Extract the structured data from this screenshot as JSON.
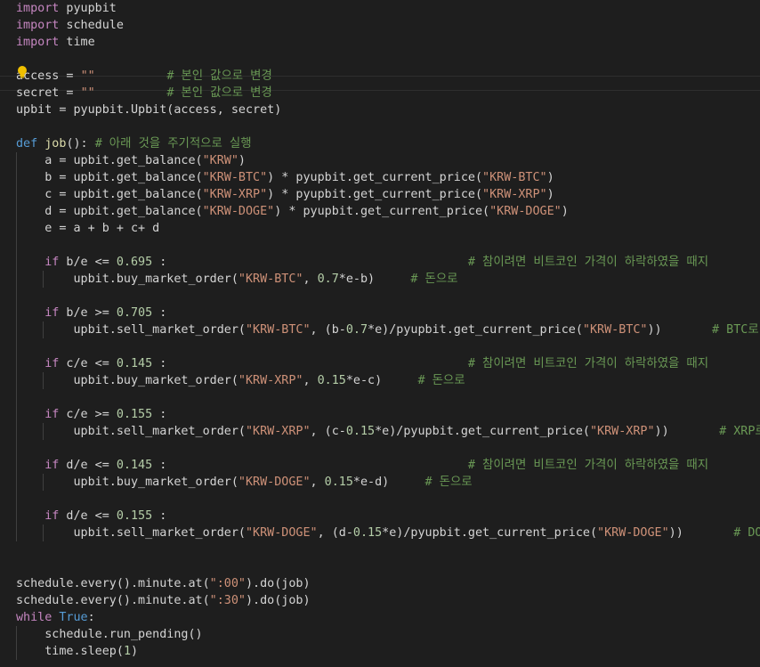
{
  "editor": {
    "lines": [
      [
        [
          "kw2",
          "import"
        ],
        [
          "tr",
          " pyupbit"
        ]
      ],
      [
        [
          "kw2",
          "import"
        ],
        [
          "tr",
          " schedule"
        ]
      ],
      [
        [
          "kw2",
          "import"
        ],
        [
          "tr",
          " time"
        ]
      ],
      [],
      [
        [
          "tr",
          "access = "
        ],
        [
          "str",
          "\"\""
        ],
        [
          "tr",
          "          "
        ],
        [
          "cm",
          "# 본인 값으로 변경"
        ]
      ],
      [
        [
          "tr",
          "secret = "
        ],
        [
          "str",
          "\"\""
        ],
        [
          "tr",
          "          "
        ],
        [
          "cm",
          "# 본인 값으로 변경"
        ]
      ],
      [
        [
          "tr",
          "upbit = pyupbit.Upbit(access, secret)"
        ]
      ],
      [],
      [
        [
          "kw",
          "def"
        ],
        [
          "tr",
          " "
        ],
        [
          "fn",
          "job"
        ],
        [
          "tr",
          "(): "
        ],
        [
          "cm",
          "# 아래 것을 주기적으로 실행"
        ]
      ],
      [
        [
          "tr",
          "    a = upbit.get_balance("
        ],
        [
          "str",
          "\"KRW\""
        ],
        [
          "tr",
          ")"
        ]
      ],
      [
        [
          "tr",
          "    b = upbit.get_balance("
        ],
        [
          "str",
          "\"KRW-BTC\""
        ],
        [
          "tr",
          ") * pyupbit.get_current_price("
        ],
        [
          "str",
          "\"KRW-BTC\""
        ],
        [
          "tr",
          ")"
        ]
      ],
      [
        [
          "tr",
          "    c = upbit.get_balance("
        ],
        [
          "str",
          "\"KRW-XRP\""
        ],
        [
          "tr",
          ") * pyupbit.get_current_price("
        ],
        [
          "str",
          "\"KRW-XRP\""
        ],
        [
          "tr",
          ")"
        ]
      ],
      [
        [
          "tr",
          "    d = upbit.get_balance("
        ],
        [
          "str",
          "\"KRW-DOGE\""
        ],
        [
          "tr",
          ") * pyupbit.get_current_price("
        ],
        [
          "str",
          "\"KRW-DOGE\""
        ],
        [
          "tr",
          ")"
        ]
      ],
      [
        [
          "tr",
          "    e = a + b + c+ d"
        ]
      ],
      [],
      [
        [
          "tr",
          "    "
        ],
        [
          "kw2",
          "if"
        ],
        [
          "tr",
          " b/e <= "
        ],
        [
          "num",
          "0.695"
        ],
        [
          "tr",
          " :                                          "
        ],
        [
          "cm",
          "# 참이려면 비트코인 가격이 하락하였을 때지"
        ]
      ],
      [
        [
          "tr",
          "        upbit.buy_market_order("
        ],
        [
          "str",
          "\"KRW-BTC\""
        ],
        [
          "tr",
          ", "
        ],
        [
          "num",
          "0.7"
        ],
        [
          "tr",
          "*e-b)     "
        ],
        [
          "cm",
          "# 돈으로"
        ]
      ],
      [],
      [
        [
          "tr",
          "    "
        ],
        [
          "kw2",
          "if"
        ],
        [
          "tr",
          " b/e >= "
        ],
        [
          "num",
          "0.705"
        ],
        [
          "tr",
          " :"
        ]
      ],
      [
        [
          "tr",
          "        upbit.sell_market_order("
        ],
        [
          "str",
          "\"KRW-BTC\""
        ],
        [
          "tr",
          ", (b-"
        ],
        [
          "num",
          "0.7"
        ],
        [
          "tr",
          "*e)/pyupbit.get_current_price("
        ],
        [
          "str",
          "\"KRW-BTC\""
        ],
        [
          "tr",
          "))       "
        ],
        [
          "cm",
          "# BTC로"
        ]
      ],
      [],
      [
        [
          "tr",
          "    "
        ],
        [
          "kw2",
          "if"
        ],
        [
          "tr",
          " c/e <= "
        ],
        [
          "num",
          "0.145"
        ],
        [
          "tr",
          " :                                          "
        ],
        [
          "cm",
          "# 참이려면 비트코인 가격이 하락하였을 때지"
        ]
      ],
      [
        [
          "tr",
          "        upbit.buy_market_order("
        ],
        [
          "str",
          "\"KRW-XRP\""
        ],
        [
          "tr",
          ", "
        ],
        [
          "num",
          "0.15"
        ],
        [
          "tr",
          "*e-c)     "
        ],
        [
          "cm",
          "# 돈으로"
        ]
      ],
      [],
      [
        [
          "tr",
          "    "
        ],
        [
          "kw2",
          "if"
        ],
        [
          "tr",
          " c/e >= "
        ],
        [
          "num",
          "0.155"
        ],
        [
          "tr",
          " :"
        ]
      ],
      [
        [
          "tr",
          "        upbit.sell_market_order("
        ],
        [
          "str",
          "\"KRW-XRP\""
        ],
        [
          "tr",
          ", (c-"
        ],
        [
          "num",
          "0.15"
        ],
        [
          "tr",
          "*e)/pyupbit.get_current_price("
        ],
        [
          "str",
          "\"KRW-XRP\""
        ],
        [
          "tr",
          "))       "
        ],
        [
          "cm",
          "# XRP로"
        ]
      ],
      [],
      [
        [
          "tr",
          "    "
        ],
        [
          "kw2",
          "if"
        ],
        [
          "tr",
          " d/e <= "
        ],
        [
          "num",
          "0.145"
        ],
        [
          "tr",
          " :                                          "
        ],
        [
          "cm",
          "# 참이려면 비트코인 가격이 하락하였을 때지"
        ]
      ],
      [
        [
          "tr",
          "        upbit.buy_market_order("
        ],
        [
          "str",
          "\"KRW-DOGE\""
        ],
        [
          "tr",
          ", "
        ],
        [
          "num",
          "0.15"
        ],
        [
          "tr",
          "*e-d)     "
        ],
        [
          "cm",
          "# 돈으로"
        ]
      ],
      [],
      [
        [
          "tr",
          "    "
        ],
        [
          "kw2",
          "if"
        ],
        [
          "tr",
          " d/e <= "
        ],
        [
          "num",
          "0.155"
        ],
        [
          "tr",
          " :"
        ]
      ],
      [
        [
          "tr",
          "        upbit.sell_market_order("
        ],
        [
          "str",
          "\"KRW-DOGE\""
        ],
        [
          "tr",
          ", (d-"
        ],
        [
          "num",
          "0.15"
        ],
        [
          "tr",
          "*e)/pyupbit.get_current_price("
        ],
        [
          "str",
          "\"KRW-DOGE\""
        ],
        [
          "tr",
          "))       "
        ],
        [
          "cm",
          "# DOGE로"
        ]
      ],
      [],
      [],
      [
        [
          "tr",
          "schedule.every().minute.at("
        ],
        [
          "str",
          "\":00\""
        ],
        [
          "tr",
          ").do(job)"
        ]
      ],
      [
        [
          "tr",
          "schedule.every().minute.at("
        ],
        [
          "str",
          "\":30\""
        ],
        [
          "tr",
          ").do(job)"
        ]
      ],
      [
        [
          "kw2",
          "while"
        ],
        [
          "tr",
          " "
        ],
        [
          "kw",
          "True"
        ],
        [
          "tr",
          ":"
        ]
      ],
      [
        [
          "tr",
          "    schedule.run_pending()"
        ]
      ],
      [
        [
          "tr",
          "    time.sleep("
        ],
        [
          "num",
          "1"
        ],
        [
          "tr",
          ")"
        ]
      ]
    ],
    "lightbulb_icon": "lightbulb-icon"
  }
}
